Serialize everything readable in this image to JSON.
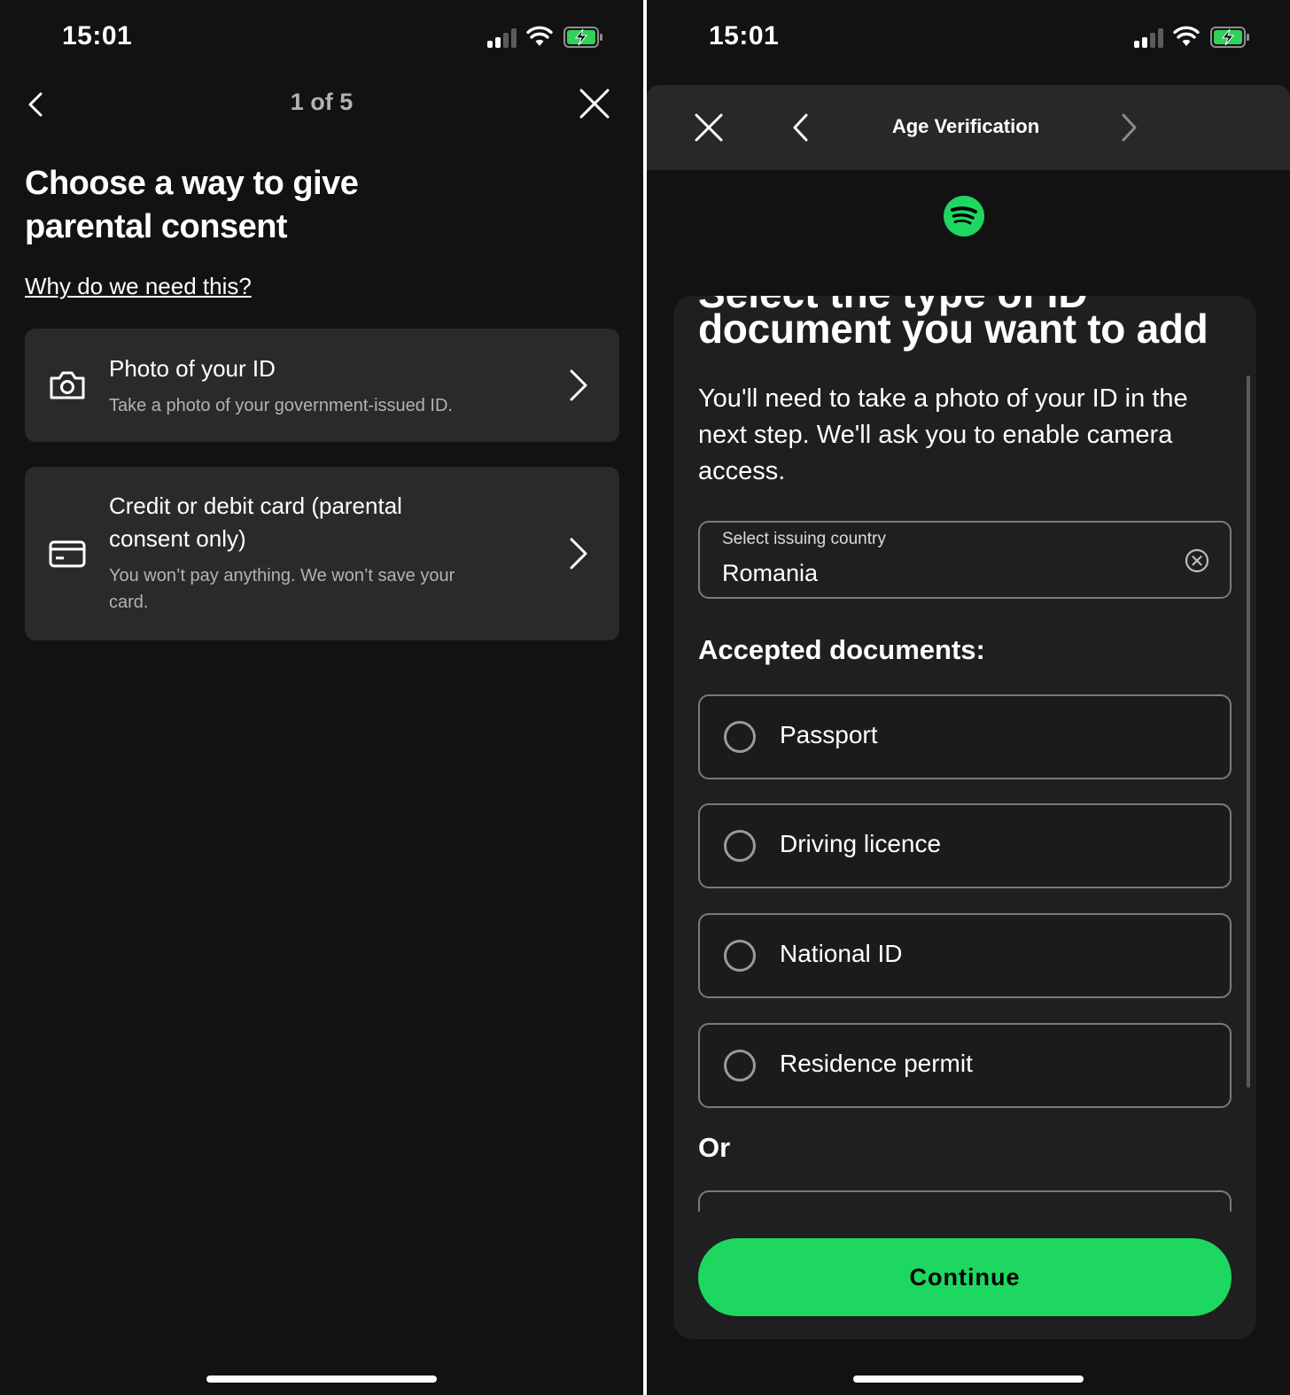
{
  "left": {
    "status": {
      "time": "15:01"
    },
    "nav": {
      "step": "1 of 5"
    },
    "title": "Choose a way to give parental consent",
    "why_link": "Why do we need this?",
    "options": [
      {
        "icon": "camera-icon",
        "title": "Photo of your ID",
        "subtitle": "Take a photo of your government-issued ID."
      },
      {
        "icon": "credit-card-icon",
        "title": "Credit or debit card (parental consent only)",
        "subtitle": "You won’t pay anything. We won’t save your card."
      }
    ]
  },
  "right": {
    "status": {
      "time": "15:01"
    },
    "header": {
      "title": "Age Verification"
    },
    "logo": "spotify-logo",
    "cut_title": "Select the type of ID",
    "doc_title": "document you want to add",
    "description": "You'll need to take a photo of your ID in the next step. We'll ask you to enable camera access.",
    "country": {
      "label": "Select issuing country",
      "value": "Romania"
    },
    "accepted_heading": "Accepted documents:",
    "documents": [
      "Passport",
      "Driving licence",
      "National ID",
      "Residence permit"
    ],
    "or_label": "Or",
    "continue_label": "Continue"
  },
  "colors": {
    "background": "#121212",
    "card": "#2a2a2a",
    "accent": "#1ed760"
  }
}
